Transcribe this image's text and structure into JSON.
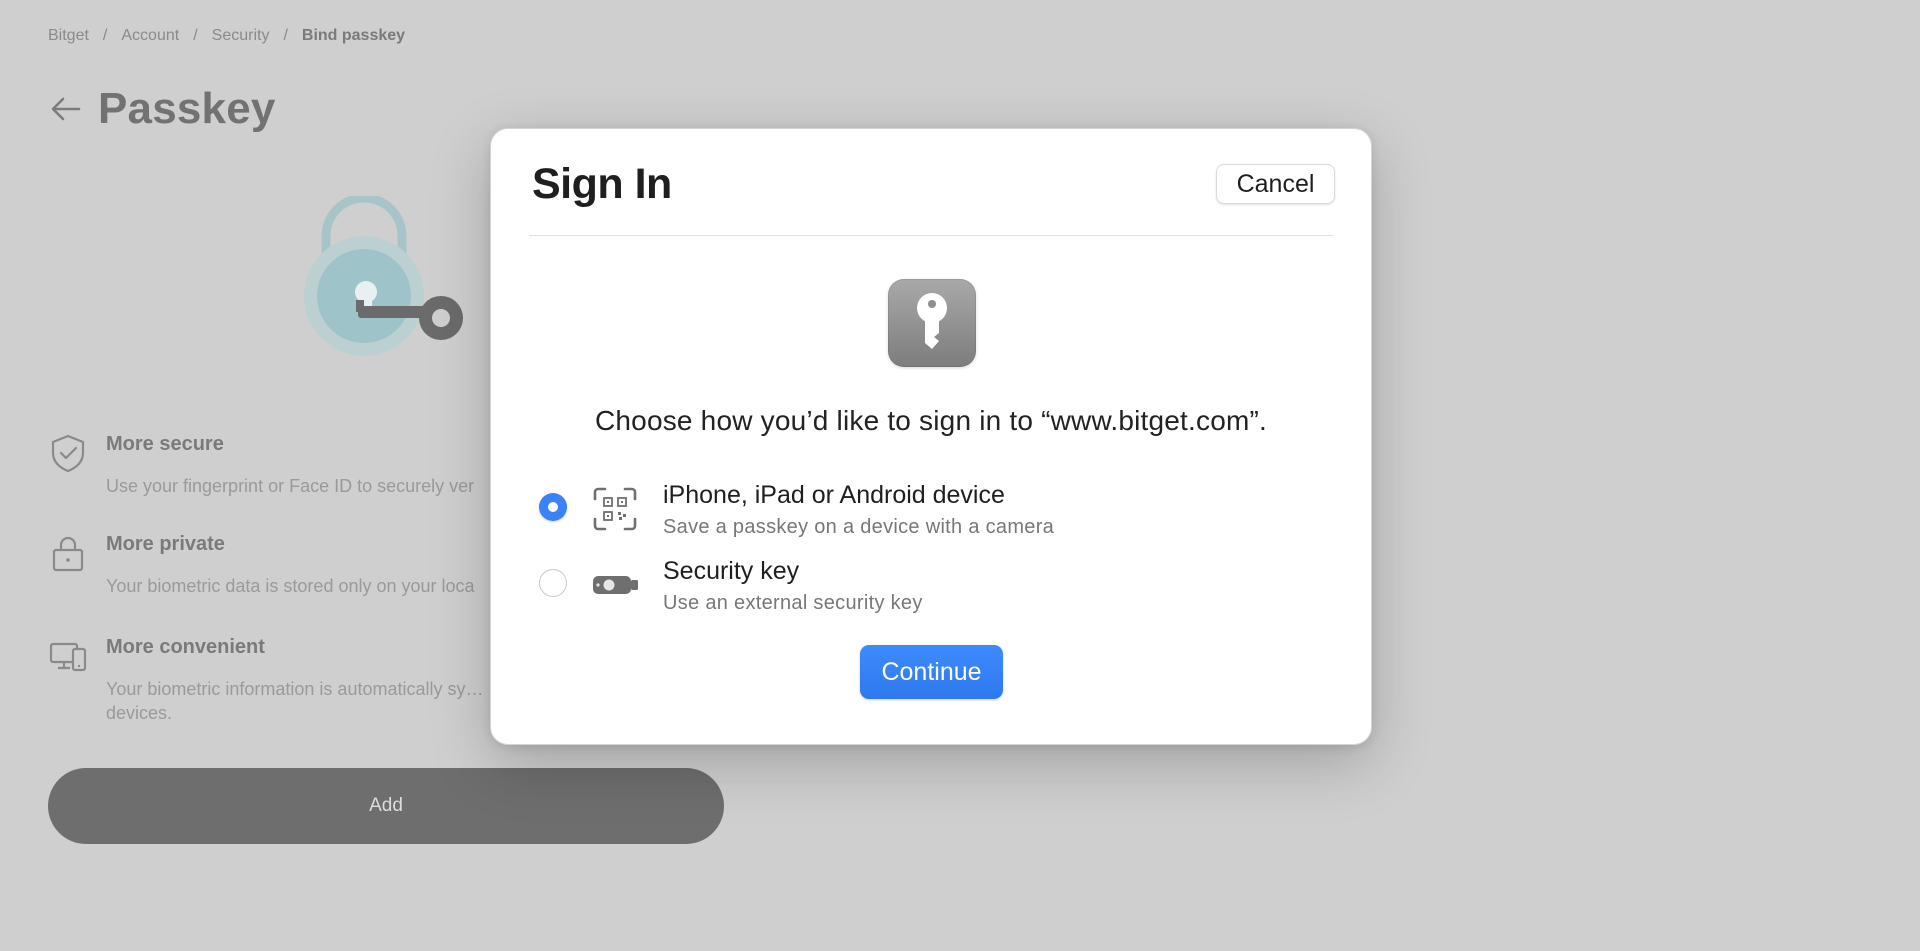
{
  "breadcrumb": {
    "items": [
      "Bitget",
      "Account",
      "Security"
    ],
    "current": "Bind passkey",
    "separator": "/"
  },
  "page": {
    "title": "Passkey"
  },
  "features": [
    {
      "title": "More secure",
      "description": "Use your fingerprint or Face ID to securely ver",
      "icon": "shield-check-icon"
    },
    {
      "title": "More private",
      "description": "Your biometric data is stored only on your loca",
      "icon": "lock-icon"
    },
    {
      "title": "More convenient",
      "description": "Your biometric information is automatically sy… devices.",
      "icon": "devices-icon"
    }
  ],
  "add_button": {
    "label": "Add"
  },
  "modal": {
    "title": "Sign In",
    "cancel_label": "Cancel",
    "prompt": "Choose how you’d like to sign in to “www.bitget.com”.",
    "options": [
      {
        "title": "iPhone, iPad or Android device",
        "subtitle": "Save a passkey on a device with a camera",
        "icon": "qr-code-icon",
        "selected": true
      },
      {
        "title": "Security key",
        "subtitle": "Use an external security key",
        "icon": "usb-key-icon",
        "selected": false
      }
    ],
    "continue_label": "Continue"
  },
  "colors": {
    "accent": "#3b82f6",
    "overlay_bg": "#cfcfcf",
    "add_button_bg": "#6e6e6e"
  }
}
